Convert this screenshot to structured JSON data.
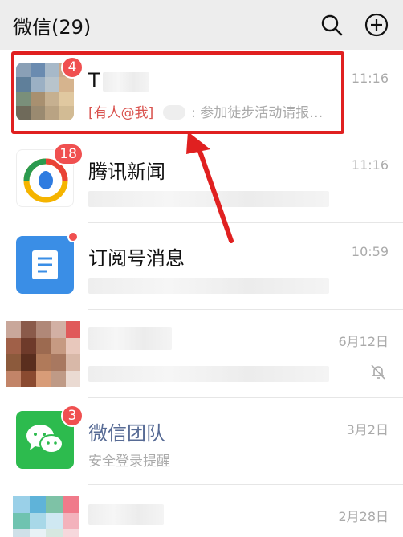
{
  "header": {
    "title": "微信(29)",
    "search_icon": "search-icon",
    "add_icon": "add-circle-icon"
  },
  "chats": [
    {
      "name": "T",
      "time": "11:16",
      "badge": "4",
      "mention": "[有人@我]",
      "preview": ": 参加徒步活动请报…"
    },
    {
      "name": "腾讯新闻",
      "time": "11:16",
      "badge": "18"
    },
    {
      "name": "订阅号消息",
      "time": "10:59"
    },
    {
      "name": "",
      "time": "6月12日",
      "muted_icon": "bell-off-icon"
    },
    {
      "name": "微信团队",
      "time": "3月2日",
      "badge": "3",
      "preview": "安全登录提醒"
    },
    {
      "name": "",
      "time": "2月28日"
    }
  ],
  "colors": {
    "accent_red": "#e02020",
    "badge_red": "#f05050",
    "wechat_green": "#2dbb4e",
    "subscription_blue": "#3a8ee6"
  }
}
